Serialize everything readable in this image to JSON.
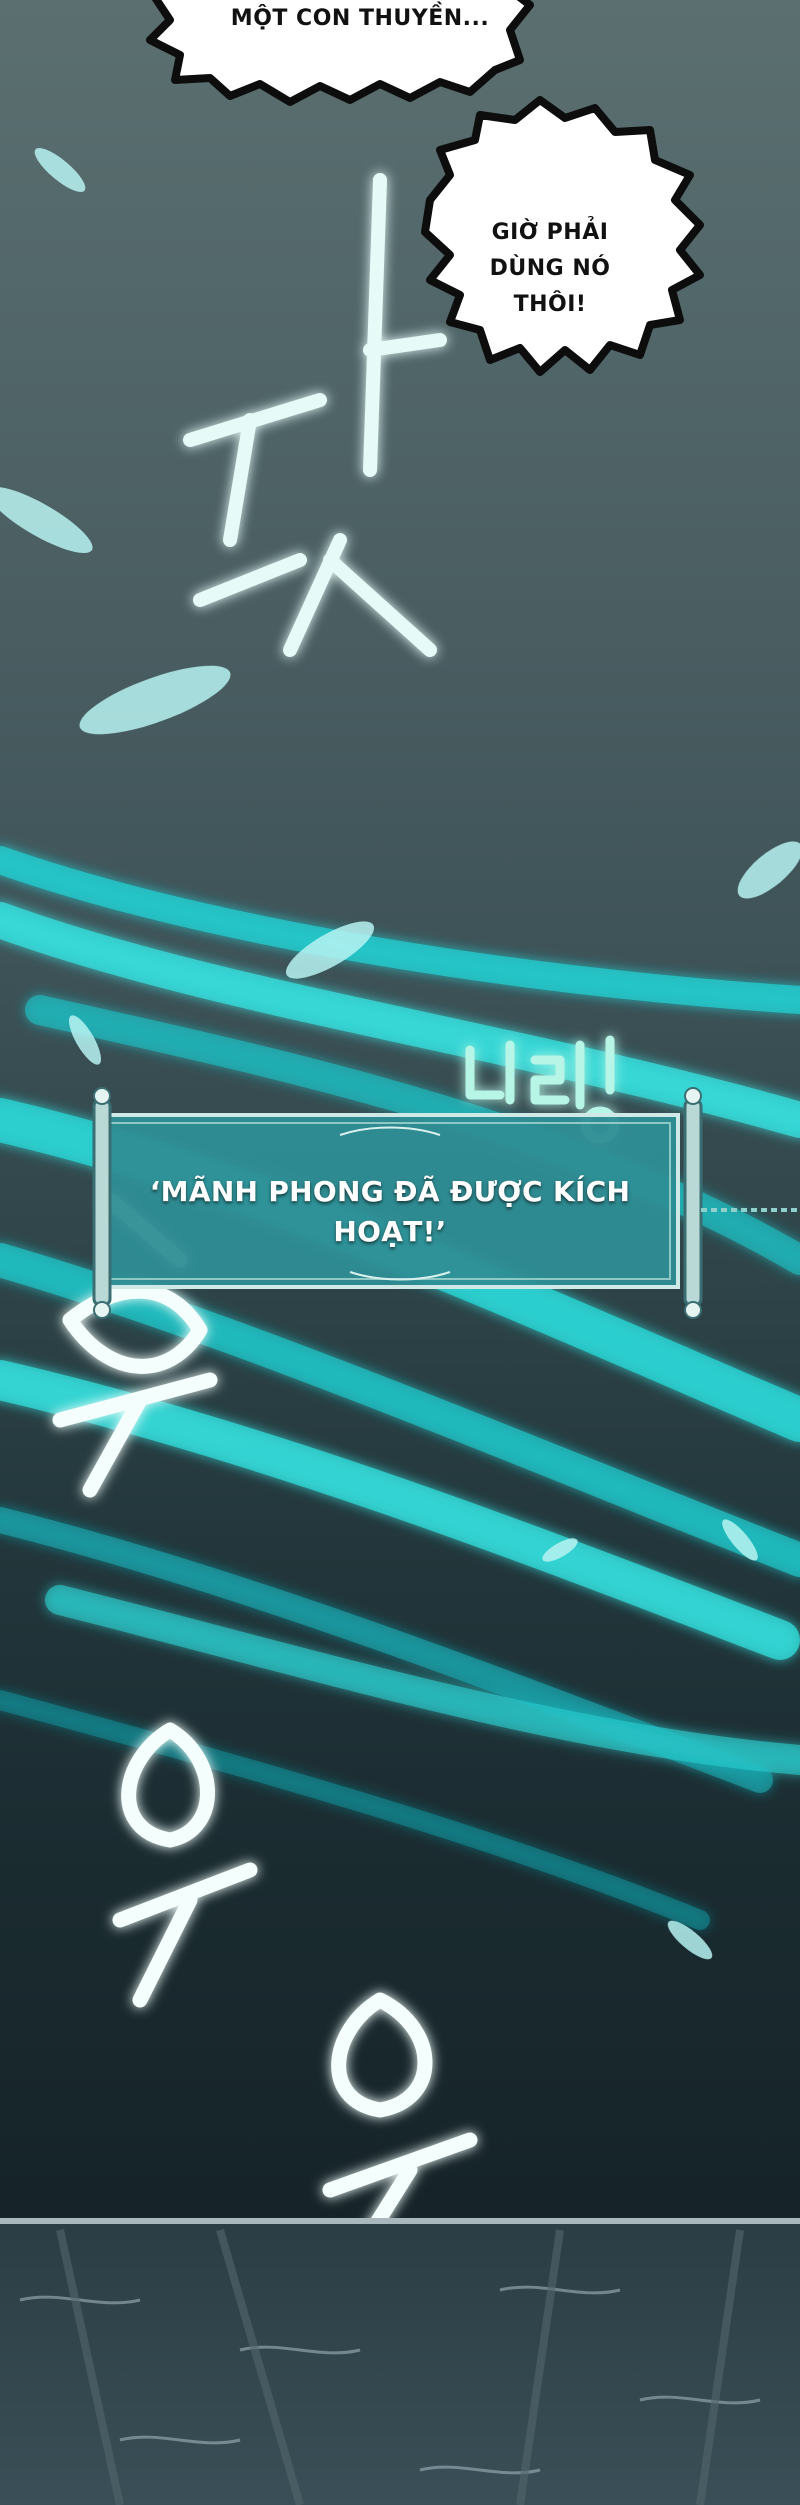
{
  "bubbles": [
    {
      "text": "MỘT CON THUYỀN..."
    },
    {
      "lines": [
        "GIỜ PHẢI",
        "DÙNG NÓ",
        "THÔI!"
      ]
    }
  ],
  "sfx": [
    {
      "text": "탓",
      "meaning": "tat"
    },
    {
      "text": "띠링",
      "meaning": "ding"
    },
    {
      "text": "후",
      "meaning": "whoosh"
    },
    {
      "text": "우",
      "meaning": "woo"
    },
    {
      "text": "우",
      "meaning": "woo"
    }
  ],
  "system_banner": {
    "text": "‘MÃNH PHONG ĐÃ ĐƯỢC KÍCH HOẠT!’"
  },
  "colors": {
    "wind": "#2fd6d6",
    "wind_light": "#9ff3f2",
    "banner_bg": "#3a9aa0",
    "bubble": "#ffffff",
    "bubble_outline": "#0d0d0d"
  }
}
